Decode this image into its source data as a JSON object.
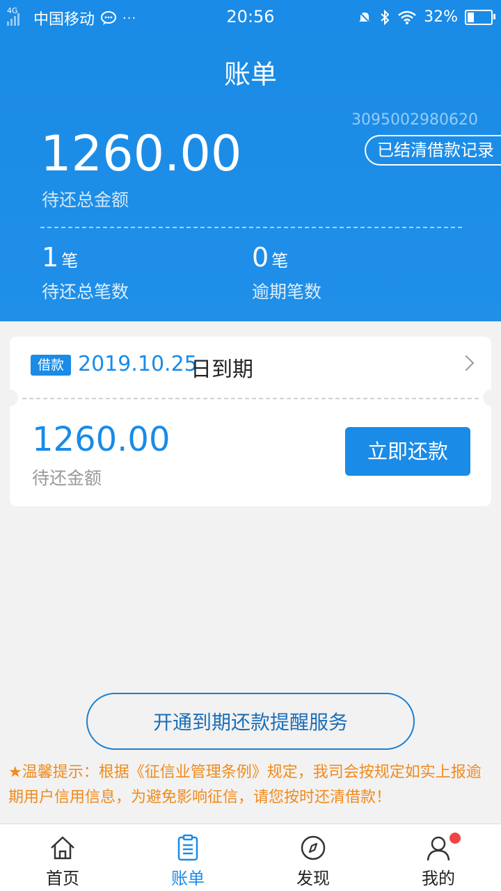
{
  "status_bar": {
    "network": "4G",
    "carrier": "中国移动",
    "more": "···",
    "time": "20:56",
    "battery": "32%",
    "battery_level": 0.32
  },
  "header": {
    "title": "账单",
    "account_number": "3095002980620",
    "history_button": "已结清借款记录",
    "total_amount": "1260.00",
    "total_label": "待还总金额",
    "pending_count": "1",
    "pending_unit": "笔",
    "pending_label": "待还总笔数",
    "overdue_count": "0",
    "overdue_unit": "笔",
    "overdue_label": "逾期笔数"
  },
  "loan_card": {
    "badge": "借款",
    "due_date": "2019.10.25",
    "due_suffix": "日到期",
    "amount": "1260.00",
    "amount_label": "待还金额",
    "pay_button": "立即还款"
  },
  "reminder_button": "开通到期还款提醒服务",
  "tip": "★温馨提示：根据《征信业管理条例》规定，我司会按规定如实上报逾期用户信用信息，为避免影响征信，请您按时还清借款！",
  "tabs": [
    {
      "label": "首页",
      "icon": "home-icon"
    },
    {
      "label": "账单",
      "icon": "bill-icon"
    },
    {
      "label": "发现",
      "icon": "compass-icon"
    },
    {
      "label": "我的",
      "icon": "user-icon"
    }
  ],
  "colors": {
    "primary": "#1a8be6",
    "tip": "#f08a1c",
    "badge": "#f04444"
  }
}
